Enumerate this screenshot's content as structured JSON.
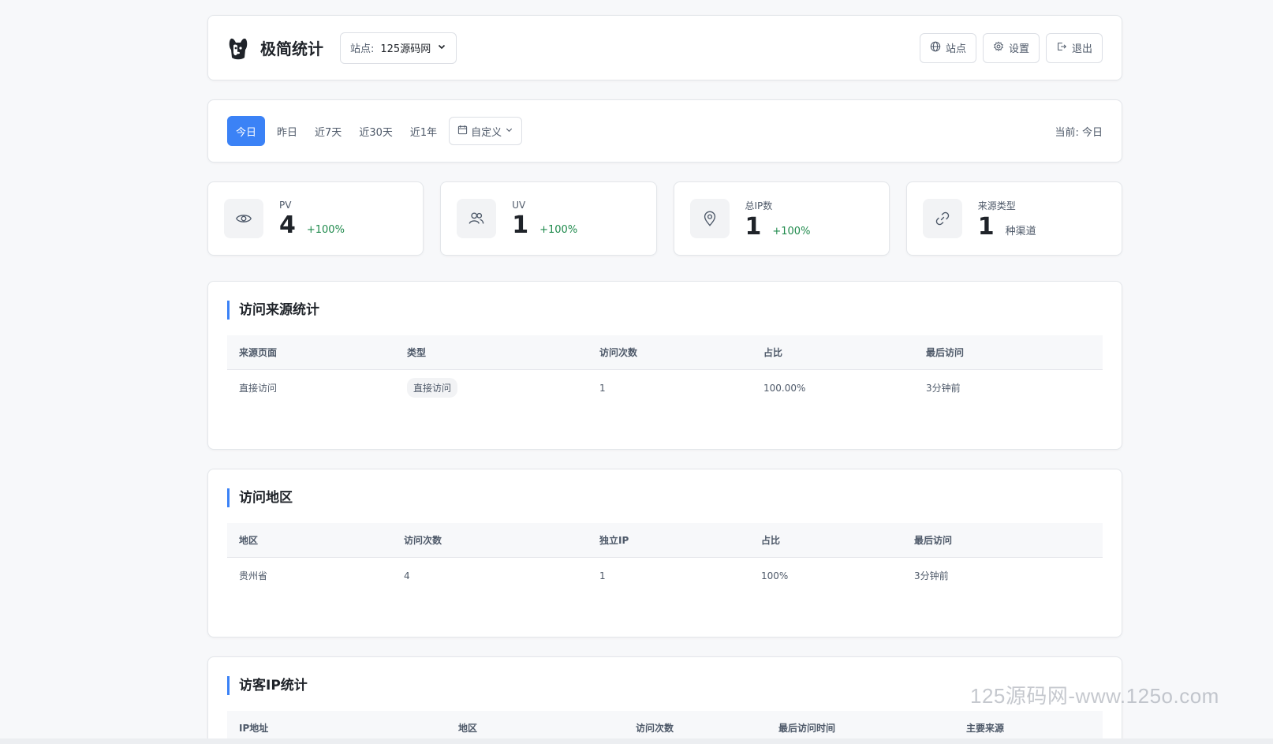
{
  "header": {
    "app_title": "极简统计",
    "site_label": "站点:",
    "site_value": "125源码网",
    "actions": [
      {
        "label": "站点",
        "icon": "globe-icon"
      },
      {
        "label": "设置",
        "icon": "gear-icon"
      },
      {
        "label": "退出",
        "icon": "logout-icon"
      }
    ]
  },
  "filter": {
    "tabs": [
      "今日",
      "昨日",
      "近7天",
      "近30天",
      "近1年"
    ],
    "active_tab": "今日",
    "custom_label": "自定义",
    "current_text": "当前: 今日"
  },
  "stats": [
    {
      "label": "PV",
      "value": "4",
      "change": "+100%",
      "icon": "eye-icon"
    },
    {
      "label": "UV",
      "value": "1",
      "change": "+100%",
      "icon": "users-icon"
    },
    {
      "label": "总IP数",
      "value": "1",
      "change": "+100%",
      "icon": "location-pin-icon"
    },
    {
      "label": "来源类型",
      "value": "1",
      "unit": "种渠道",
      "icon": "link-icon"
    }
  ],
  "sources": {
    "title": "访问来源统计",
    "columns": [
      "来源页面",
      "类型",
      "访问次数",
      "占比",
      "最后访问"
    ],
    "rows": [
      [
        "直接访问",
        "直接访问",
        "1",
        "100.00%",
        "3分钟前"
      ]
    ]
  },
  "regions": {
    "title": "访问地区",
    "columns": [
      "地区",
      "访问次数",
      "独立IP",
      "占比",
      "最后访问"
    ],
    "rows": [
      [
        "贵州省",
        "4",
        "1",
        "100%",
        "3分钟前"
      ]
    ]
  },
  "ips": {
    "title": "访客IP统计",
    "columns": [
      "IP地址",
      "地区",
      "访问次数",
      "最后访问时间",
      "主要来源"
    ]
  },
  "watermark": "125源码网-www.125o.com",
  "colors": {
    "accent": "#3b82f6",
    "positive": "#1f8a4c",
    "background": "#f7f8fa"
  }
}
